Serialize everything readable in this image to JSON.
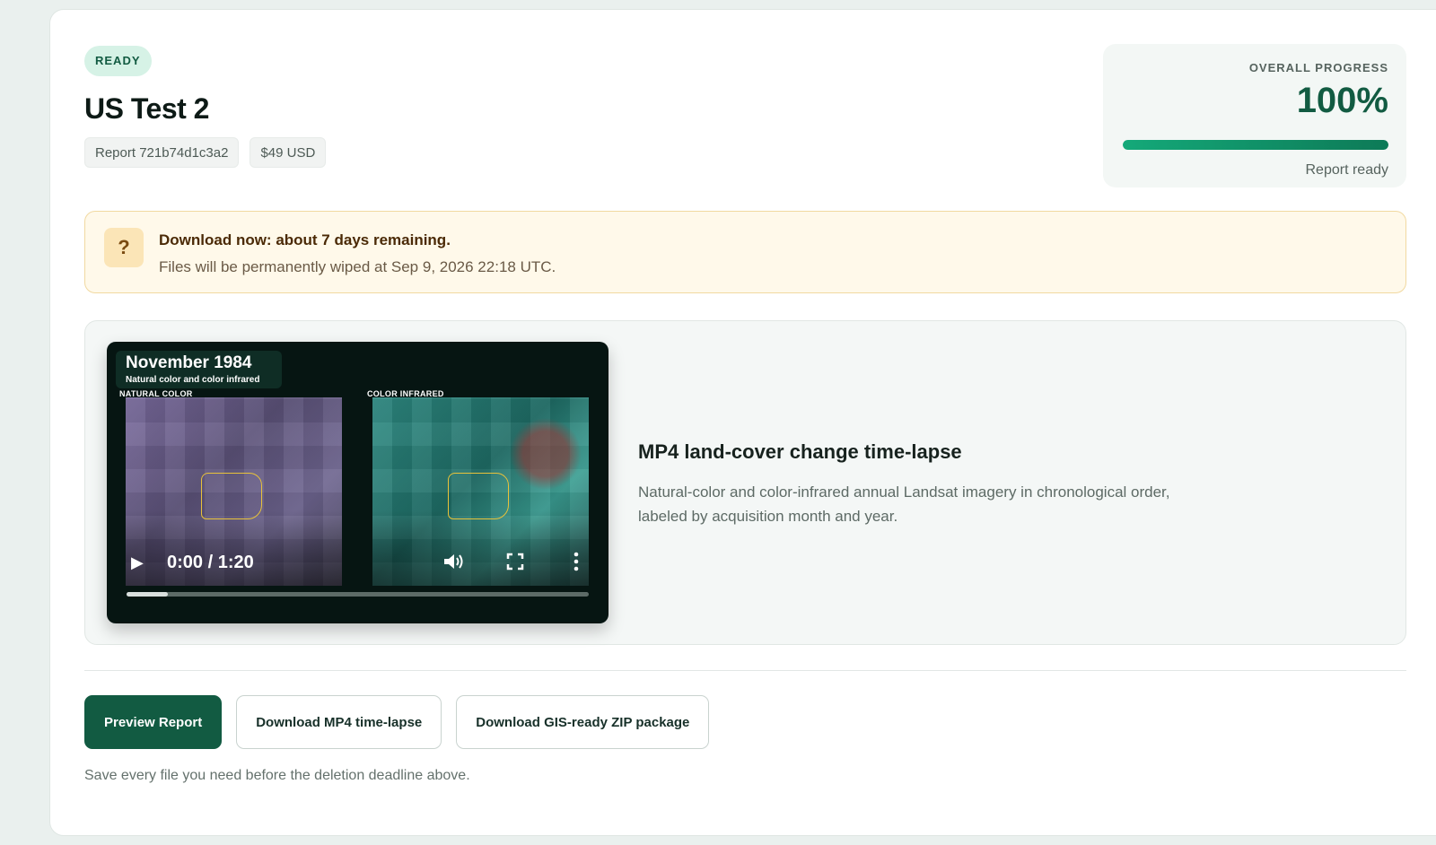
{
  "status": {
    "label": "READY"
  },
  "report": {
    "title": "US Test 2",
    "id_chip": "Report 721b74d1c3a2",
    "price_chip": "$49 USD"
  },
  "progress": {
    "label": "OVERALL PROGRESS",
    "value_text": "100%",
    "value": 100,
    "status": "Report ready"
  },
  "notice": {
    "icon": "?",
    "title": "Download now: about 7 days remaining.",
    "text": "Files will be permanently wiped at Sep 9, 2026 22:18 UTC."
  },
  "video": {
    "month_label": "November 1984",
    "subtitle": "Natural color and color infrared",
    "left_panel_label": "NATURAL COLOR",
    "right_panel_label": "COLOR INFRARED",
    "time": "0:00 / 1:20",
    "seek_fraction": 0.09
  },
  "media": {
    "title": "MP4 land-cover change time-lapse",
    "description": "Natural-color and color-infrared annual Landsat imagery in chronological order, labeled by acquisition month and year."
  },
  "actions": {
    "preview": "Preview Report",
    "download_mp4": "Download MP4 time-lapse",
    "download_zip": "Download GIS-ready ZIP package"
  },
  "footnote": "Save every file you need before the deletion deadline above.",
  "colors": {
    "brand": "#125b42",
    "progress": "#14a979",
    "notice_bg": "#fff9ea"
  }
}
